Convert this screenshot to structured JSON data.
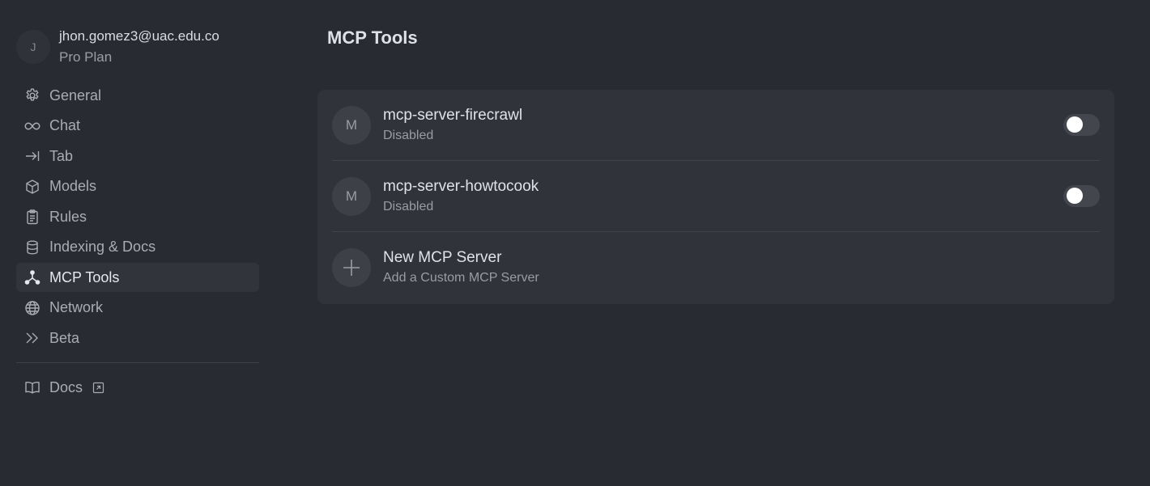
{
  "user": {
    "avatar_initial": "J",
    "email": "jhon.gomez3@uac.edu.co",
    "plan": "Pro Plan"
  },
  "sidebar": {
    "items": [
      {
        "label": "General",
        "icon": "gear-icon"
      },
      {
        "label": "Chat",
        "icon": "infinity-icon"
      },
      {
        "label": "Tab",
        "icon": "tab-arrow-icon"
      },
      {
        "label": "Models",
        "icon": "cube-icon"
      },
      {
        "label": "Rules",
        "icon": "clipboard-icon"
      },
      {
        "label": "Indexing & Docs",
        "icon": "database-icon"
      },
      {
        "label": "MCP Tools",
        "icon": "nodes-icon",
        "active": true
      },
      {
        "label": "Network",
        "icon": "globe-icon"
      },
      {
        "label": "Beta",
        "icon": "double-chevron-icon"
      }
    ],
    "docs": {
      "label": "Docs",
      "icon": "book-icon",
      "external_icon": "external-link-icon"
    }
  },
  "main": {
    "title": "MCP Tools",
    "servers": [
      {
        "avatar_initial": "M",
        "name": "mcp-server-firecrawl",
        "status": "Disabled",
        "enabled": false
      },
      {
        "avatar_initial": "M",
        "name": "mcp-server-howtocook",
        "status": "Disabled",
        "enabled": false
      }
    ],
    "new_server": {
      "title": "New MCP Server",
      "subtitle": "Add a Custom MCP Server",
      "icon": "plus-icon"
    }
  },
  "colors": {
    "background": "#292b33",
    "panel": "#31333b",
    "active_nav": "#32343c",
    "toggle_off": "#44464e"
  }
}
